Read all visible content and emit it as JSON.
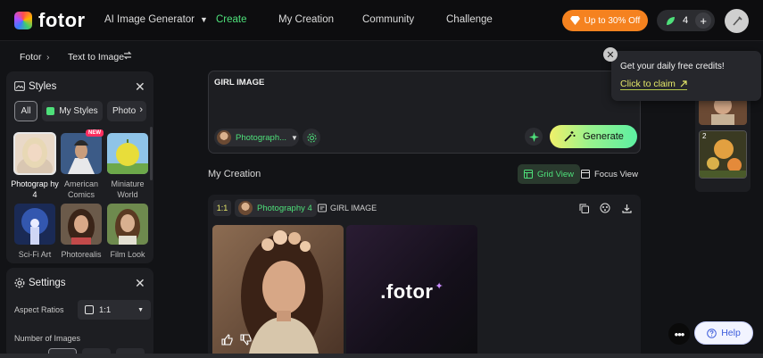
{
  "nav": {
    "logo_text": "fotor",
    "items": [
      {
        "label": "AI Image Generator",
        "has_caret": true
      },
      {
        "label": "Create",
        "active": true
      },
      {
        "label": "My Creation"
      },
      {
        "label": "Community"
      },
      {
        "label": "Challenge"
      }
    ],
    "promo_label": "Up to 30% Off",
    "credits_count": "4"
  },
  "breadcrumb": {
    "root": "Fotor",
    "current": "Text to Image"
  },
  "styles_panel": {
    "title": "Styles",
    "chips": [
      "All",
      "My Styles",
      "Photo"
    ],
    "items": [
      {
        "label": "Photograp hy 4",
        "selected": true
      },
      {
        "label": "American Comics",
        "badge": "NEW"
      },
      {
        "label": "Miniature World"
      },
      {
        "label": "Sci-Fi Art"
      },
      {
        "label": "Photorealis"
      },
      {
        "label": "Film Look"
      }
    ]
  },
  "settings_panel": {
    "title": "Settings",
    "aspect_label": "Aspect Ratios",
    "aspect_value": "1:1",
    "number_label": "Number of Images"
  },
  "prompt": {
    "text": "GIRL IMAGE",
    "style_name": "Photograph...",
    "generate_label": "Generate"
  },
  "popup": {
    "title": "Get your daily free credits!",
    "link": "Click to claim"
  },
  "creation": {
    "title": "My Creation",
    "grid_view": "Grid View",
    "focus_view": "Focus View",
    "ratio": "1:1",
    "style_tag": "Photography 4",
    "prompt_tag": "GIRL IMAGE",
    "watermark": ".fotor"
  },
  "history": {
    "second_index": "2"
  },
  "help_label": "Help",
  "colors": {
    "accent_green": "#4ee07a",
    "promo_orange": "#f5821f",
    "bg": "#121316"
  }
}
